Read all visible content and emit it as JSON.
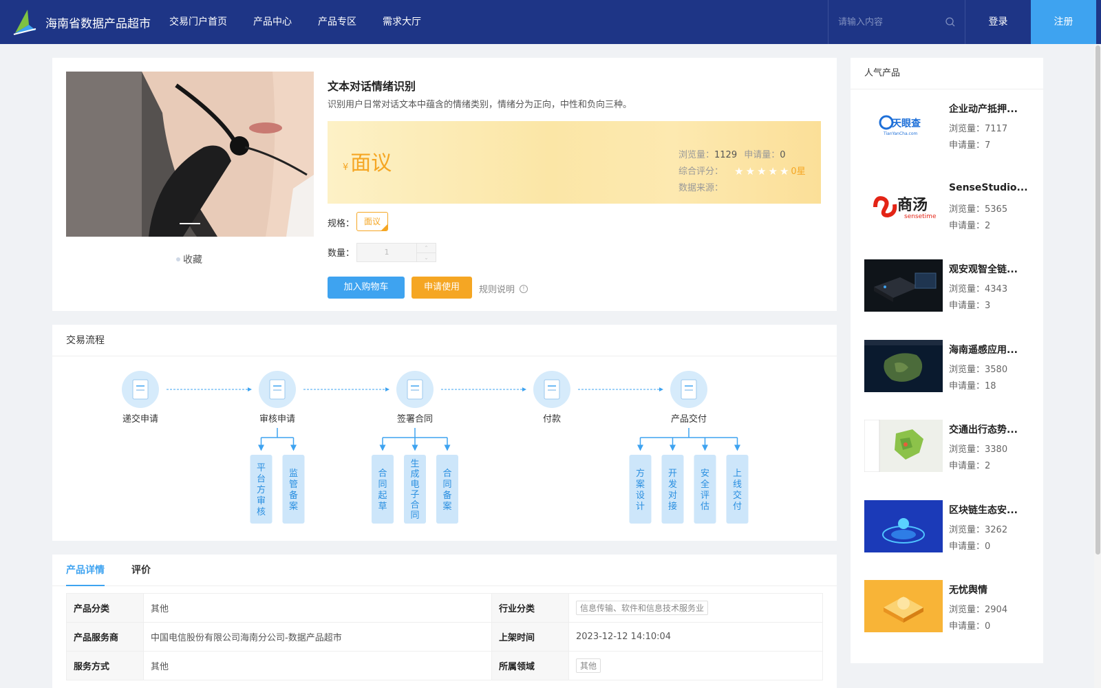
{
  "header": {
    "site_title": "海南省数据产品超市",
    "nav": [
      "交易门户首页",
      "产品中心",
      "产品专区",
      "需求大厅"
    ],
    "search_placeholder": "请输入内容",
    "login": "登录",
    "register": "注册",
    "colors": {
      "bar": "#1e3586",
      "register": "#3ea3f0"
    }
  },
  "product": {
    "title": "文本对话情绪识别",
    "description": "识别用户日常对话文本中蕴含的情绪类别，情绪分为正向，中性和负向三种。",
    "collect": "收藏",
    "price_symbol": "¥",
    "price": "面议",
    "views_label": "浏览量：",
    "views": "1129",
    "applications_label": "申请量：",
    "applications": "0",
    "rating_label": "综合评分：",
    "rating_stars": 0,
    "rating_text": "0星",
    "source_label": "数据来源：",
    "spec_label": "规格：",
    "spec_value": "面议",
    "qty_label": "数量：",
    "qty_value": "1",
    "add_cart": "加入购物车",
    "apply": "申请使用",
    "rules": "规则说明",
    "colors": {
      "accent": "#f5a623",
      "primary": "#3ea3f0"
    }
  },
  "flow": {
    "title": "交易流程",
    "steps": [
      {
        "label": "递交申请",
        "subs": []
      },
      {
        "label": "审核申请",
        "subs": [
          "平台方审核",
          "监管备案"
        ]
      },
      {
        "label": "签署合同",
        "subs": [
          "合同起草",
          "生成电子合同",
          "合同备案"
        ]
      },
      {
        "label": "付款",
        "subs": []
      },
      {
        "label": "产品交付",
        "subs": [
          "方案设计",
          "开发对接",
          "安全评估",
          "上线交付"
        ]
      }
    ]
  },
  "details": {
    "tabs": [
      "产品详情",
      "评价"
    ],
    "rows": [
      {
        "k1": "产品分类",
        "v1": "其他",
        "k2": "行业分类",
        "v2": "信息传输、软件和信息技术服务业",
        "v2_tag": true
      },
      {
        "k1": "产品服务商",
        "v1": "中国电信股份有限公司海南分公司-数据产品超市",
        "k2": "上架时间",
        "v2": "2023-12-12 14:10:04",
        "v2_tag": false
      },
      {
        "k1": "服务方式",
        "v1": "其他",
        "k2": "所属领域",
        "v2": "其他",
        "v2_tag": true
      }
    ]
  },
  "sidebar": {
    "title": "人气产品",
    "views_label": "浏览量：",
    "applications_label": "申请量：",
    "items": [
      {
        "name": "企业动产抵押...",
        "views": "7117",
        "applications": "7",
        "thumb": "tianyancha-logo"
      },
      {
        "name": "SenseStudio...",
        "views": "5365",
        "applications": "2",
        "thumb": "sensetime-logo"
      },
      {
        "name": "观安观智全链...",
        "views": "4343",
        "applications": "3",
        "thumb": "device-photo"
      },
      {
        "name": "海南遥感应用...",
        "views": "3580",
        "applications": "18",
        "thumb": "satellite-map"
      },
      {
        "name": "交通出行态势...",
        "views": "3380",
        "applications": "2",
        "thumb": "traffic-map"
      },
      {
        "name": "区块链生态安...",
        "views": "3262",
        "applications": "0",
        "thumb": "blockchain-art"
      },
      {
        "name": "无忧舆情",
        "views": "2904",
        "applications": "0",
        "thumb": "orange-art"
      }
    ],
    "logo_text": {
      "tianyancha": "天眼查",
      "tianyancha_sub": "TianYanCha.com",
      "sensetime_cn": "商汤",
      "sensetime_en": "sensetime"
    }
  }
}
